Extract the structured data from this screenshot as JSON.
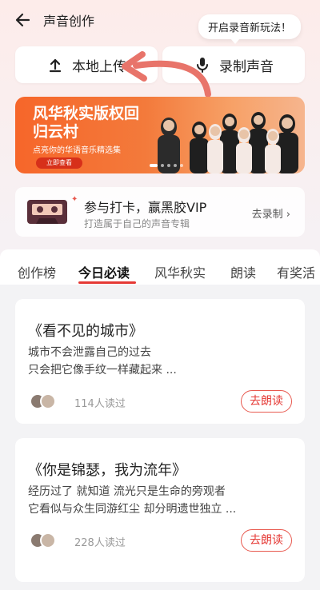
{
  "header": {
    "title": "声音创作"
  },
  "tooltip": {
    "text": "开启录音新玩法！"
  },
  "actions": {
    "upload": "本地上传",
    "record": "录制声音"
  },
  "banner": {
    "title": "风华秋实版权回归云村",
    "subtitle": "点亮你的华语音乐精选集",
    "cta": "立即查看"
  },
  "vip": {
    "title": "参与打卡，赢黑胶VIP",
    "subtitle": "打造属于自己的声音专辑",
    "link": "去录制"
  },
  "tabs": [
    "创作榜",
    "今日必读",
    "风华秋实",
    "朗读",
    "有奖活"
  ],
  "active_tab": "今日必读",
  "cards": [
    {
      "title": "《看不见的城市》",
      "lines": [
        "城市不会泄露自己的过去",
        "只会把它像手纹一样藏起来 ..."
      ],
      "reads": "114人读过",
      "button": "去朗读"
    },
    {
      "title": "《你是锦瑟，我为流年》",
      "lines": [
        "经历过了 就知道 流光只是生命的旁观者",
        "它看似与众生同游红尘 却分明遗世独立 ..."
      ],
      "reads": "228人读过",
      "button": "去朗读"
    }
  ],
  "colors": {
    "accent": "#e53935",
    "banner": "#f6662a"
  }
}
